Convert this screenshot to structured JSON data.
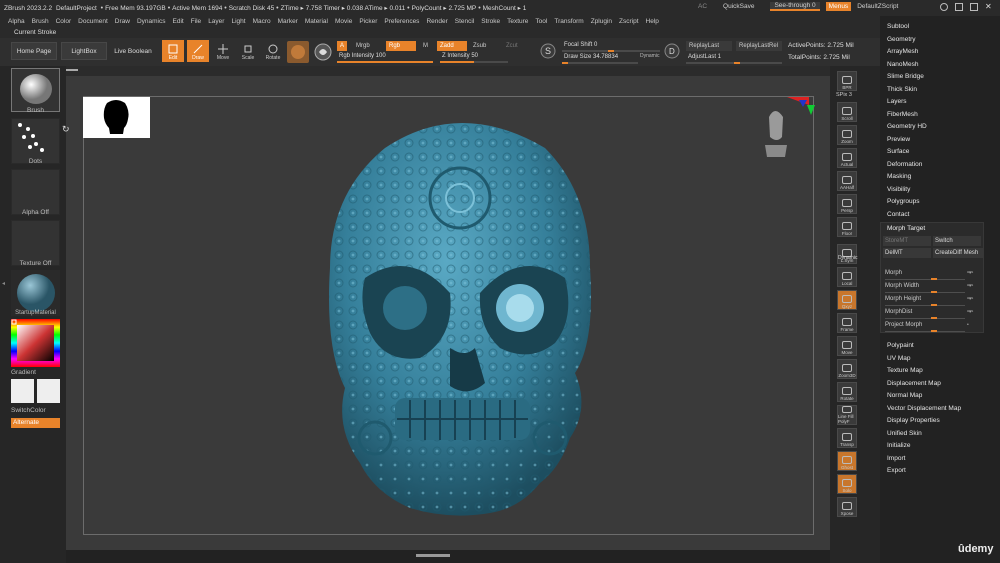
{
  "app": {
    "title": "ZBrush 2023.2.2",
    "project": "DefaultProject",
    "free_mem": "Free Mem 93.197GB",
    "active_mem": "Active Mem 1694",
    "scratch": "Scratch Disk 45",
    "ztime": "ZTime ▸ 7.758 Timer ▸ 0.038 ATime ▸ 0.011",
    "polycount": "PolyCount ▸ 2.725 MP",
    "meshcount": "MeshCount ▸ 1"
  },
  "titlebar_right": {
    "ac": "AC",
    "quicksave": "QuickSave",
    "see_through": "See-through  0",
    "menus": "Menus",
    "default_zscript": "DefaultZScript"
  },
  "menu_items": [
    "Alpha",
    "Brush",
    "Color",
    "Document",
    "Draw",
    "Dynamics",
    "Edit",
    "File",
    "Layer",
    "Light",
    "Macro",
    "Marker",
    "Material",
    "Movie",
    "Picker",
    "Preferences",
    "Render",
    "Stencil",
    "Stroke",
    "Texture",
    "Tool",
    "Transform",
    "Zplugin",
    "Zscript",
    "Help"
  ],
  "current_stroke": "Current Stroke",
  "toolbar": {
    "home_page": "Home Page",
    "lightbox": "LightBox",
    "live_boolean": "Live Boolean",
    "edit": "Edit",
    "draw": "Draw",
    "move": "Move",
    "scale": "Scale",
    "rotate": "Rotate",
    "a": "A",
    "mrgb": "Mrgb",
    "rgb": "Rgb",
    "m": "M",
    "zadd": "Zadd",
    "zsub": "Zsub",
    "zcut": "Zcut",
    "rgb_intensity": "Rgb Intensity 100",
    "z_intensity": "Z Intensity 50",
    "rgb_intensity_value": 100,
    "z_intensity_value": 50,
    "focal_shift": "Focal Shift 0",
    "draw_size": "Draw Size 34.78834",
    "dynamic": "Dynamic",
    "replay_last": "ReplayLast",
    "replay_last_rel": "ReplayLastRel",
    "adjust_last": "AdjustLast 1",
    "active_points": "ActivePoints: 2.725 Mil",
    "total_points": "TotalPoints: 2.725 Mil"
  },
  "left_panel": {
    "brush": "Brush",
    "dots": "Dots",
    "alpha": "Alpha Off",
    "texture": "Texture Off",
    "material": "StartupMaterial",
    "gradient": "Gradient",
    "switch_color": "SwitchColor",
    "alternate": "Alternate"
  },
  "right_shelf": [
    "BPR",
    "SPix 3",
    "Scroll",
    "Zoom",
    "Actual",
    "AAHalf",
    "Persp",
    "Floor",
    "L.Sym",
    "Local",
    "Qxyz",
    "Frame",
    "Move",
    "Zoom3D",
    "Rotate",
    "Line Fill PolyF",
    "Transp",
    "Ghost",
    "Solo",
    "Xpose"
  ],
  "right_shelf_labels": {
    "dynamic": "Dynamic",
    "spix": "SPix 3"
  },
  "tool_panel": {
    "top_items": [
      "Subtool",
      "Geometry",
      "ArrayMesh",
      "NanoMesh",
      "Slime Bridge",
      "Thick Skin",
      "Layers",
      "FiberMesh",
      "Geometry HD",
      "Preview",
      "Surface",
      "Deformation",
      "Masking",
      "Visibility",
      "Polygroups",
      "Contact"
    ],
    "bottom_items": [
      "Polypaint",
      "UV Map",
      "Texture Map",
      "Displacement Map",
      "Normal Map",
      "Vector Displacement Map",
      "Display Properties",
      "Unified Skin",
      "Initialize",
      "Import",
      "Export"
    ]
  },
  "morph_target": {
    "title": "Morph Target",
    "storemt": "StoreMT",
    "switch": "Switch",
    "delmt": "DelMT",
    "create_diff": "CreateDiff Mesh",
    "morph": "Morph",
    "morph_width": "Morph Width",
    "morph_height": "Morph Height",
    "morph_dist": "MorphDist",
    "project_morph": "Project Morph"
  },
  "watermark": "ûdemy",
  "colors": {
    "accent": "#e8832a",
    "skull": "#3d8aa6"
  }
}
